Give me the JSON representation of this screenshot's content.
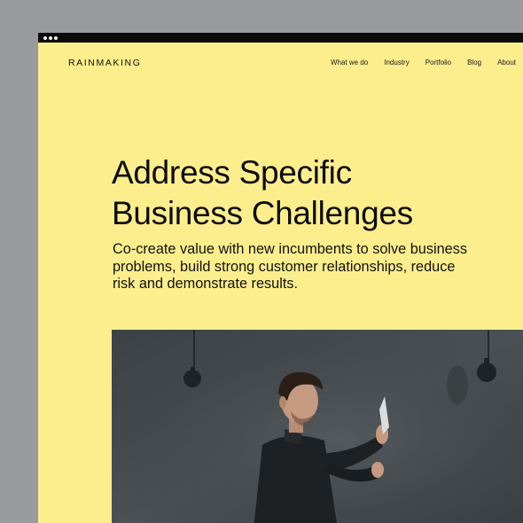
{
  "browser": {
    "chrome_dots": [
      "dot",
      "dot",
      "dot"
    ]
  },
  "header": {
    "logo": "RAINMAKING",
    "nav": [
      {
        "label": "What we do"
      },
      {
        "label": "Industry"
      },
      {
        "label": "Portfolio"
      },
      {
        "label": "Blog"
      },
      {
        "label": "About"
      }
    ]
  },
  "hero": {
    "title_line1": "Address Specific",
    "title_line2": "Business Challenges",
    "subtitle_line1": "Co-create value with new incumbents to solve business",
    "subtitle_line2": "problems, build strong customer relationships, reduce",
    "subtitle_line3": "risk and demonstrate results."
  },
  "colors": {
    "page_background": "#fcee8d",
    "outer_background": "#9a9b9d",
    "chrome_bar": "#0c0c0c",
    "text": "#0d0d0d"
  },
  "icons": {
    "window_controls": "three-dots-icon"
  }
}
